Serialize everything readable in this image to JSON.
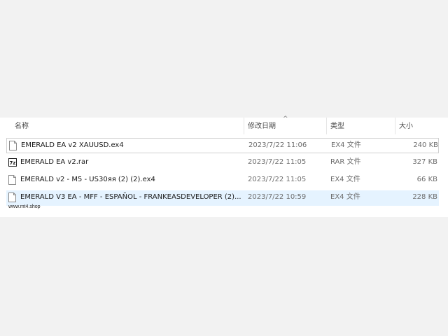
{
  "columns": {
    "name": "名称",
    "modified": "修改日期",
    "type": "类型",
    "size": "大小",
    "sort_indicator": "^"
  },
  "files": [
    {
      "name": "EMERALD EA v2  XAUUSD.ex4",
      "modified": "2023/7/22 11:06",
      "type": "EX4 文件",
      "size": "240 KB",
      "icon": "file-icon"
    },
    {
      "name": "EMERALD EA v2.rar",
      "modified": "2023/7/22 11:05",
      "type": "RAR 文件",
      "size": "327 KB",
      "icon": "7zip-archive-icon"
    },
    {
      "name": "EMERALD v2 - M5 - US30яя (2) (2).ex4",
      "modified": "2023/7/22 11:05",
      "type": "EX4 文件",
      "size": "66 KB",
      "icon": "file-icon"
    },
    {
      "name": "EMERALD V3 EA - MFF - ESPAÑOL -  FRANKEASDEVELOPER (2)....",
      "modified": "2023/7/22 10:59",
      "type": "EX4 文件",
      "size": "228 KB",
      "icon": "file-icon"
    }
  ],
  "watermark": "www.mt4.shop",
  "colors": {
    "selected_row": "#e5f3ff",
    "focus_border": "#d0d0d0",
    "background": "#f2f2f2"
  }
}
